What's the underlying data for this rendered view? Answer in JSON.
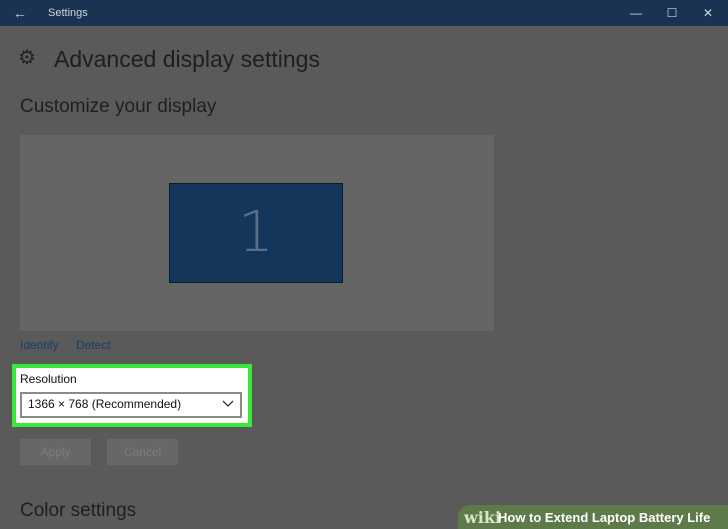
{
  "window": {
    "title": "Settings",
    "back_icon": "back-arrow-icon",
    "controls": {
      "minimize": "—",
      "maximize": "☐",
      "close": "✕"
    }
  },
  "header": {
    "title": "Advanced display settings",
    "icon": "gear-icon"
  },
  "customize": {
    "heading": "Customize your display",
    "monitor_number": "1",
    "identify_link": "Identify",
    "detect_link": "Detect"
  },
  "resolution": {
    "label": "Resolution",
    "selected": "1366 × 768 (Recommended)"
  },
  "buttons": {
    "apply": "Apply",
    "cancel": "Cancel"
  },
  "color_settings": {
    "heading": "Color settings"
  },
  "watermark": {
    "brand": "wiki",
    "text": "How to Extend Laptop Battery Life"
  },
  "colors": {
    "titlebar": "#1a3352",
    "highlight": "#39e83a",
    "link": "#1a3f66",
    "monitor": "#14365a"
  }
}
